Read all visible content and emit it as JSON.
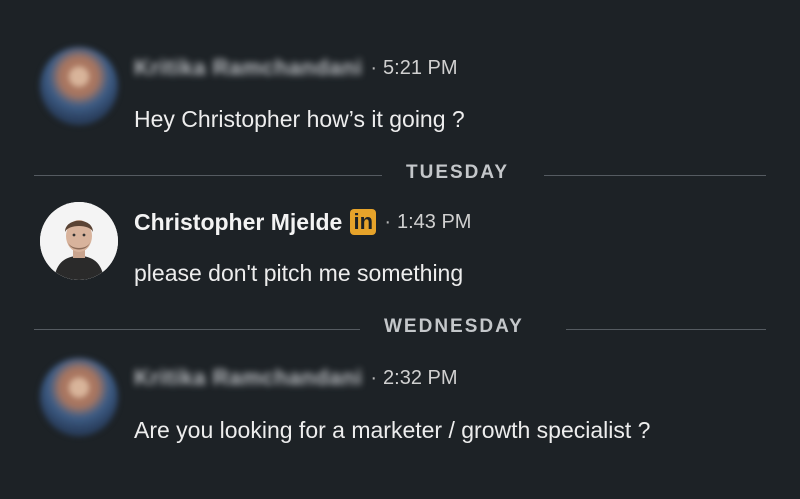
{
  "messages": [
    {
      "sender": "Kritika Ramchandani",
      "time": "5:21 PM",
      "text": "Hey Christopher how’s it going ?",
      "avatar": "blurred-avatar"
    },
    {
      "sender": "Christopher Mjelde",
      "badge": "in",
      "time": "1:43 PM",
      "text": "please don't pitch me something",
      "avatar": "profile-photo"
    },
    {
      "sender": "Kritika Ramchandani",
      "time": "2:32 PM",
      "text": "Are you looking for a marketer / growth specialist ?",
      "avatar": "blurred-avatar"
    }
  ],
  "dividers": [
    {
      "label": "TUESDAY"
    },
    {
      "label": "WEDNESDAY"
    }
  ],
  "separator": "·",
  "colors": {
    "background": "#1d2226",
    "badge": "#e6a32a",
    "text": "#ededed",
    "divider_rule": "#555b61"
  }
}
